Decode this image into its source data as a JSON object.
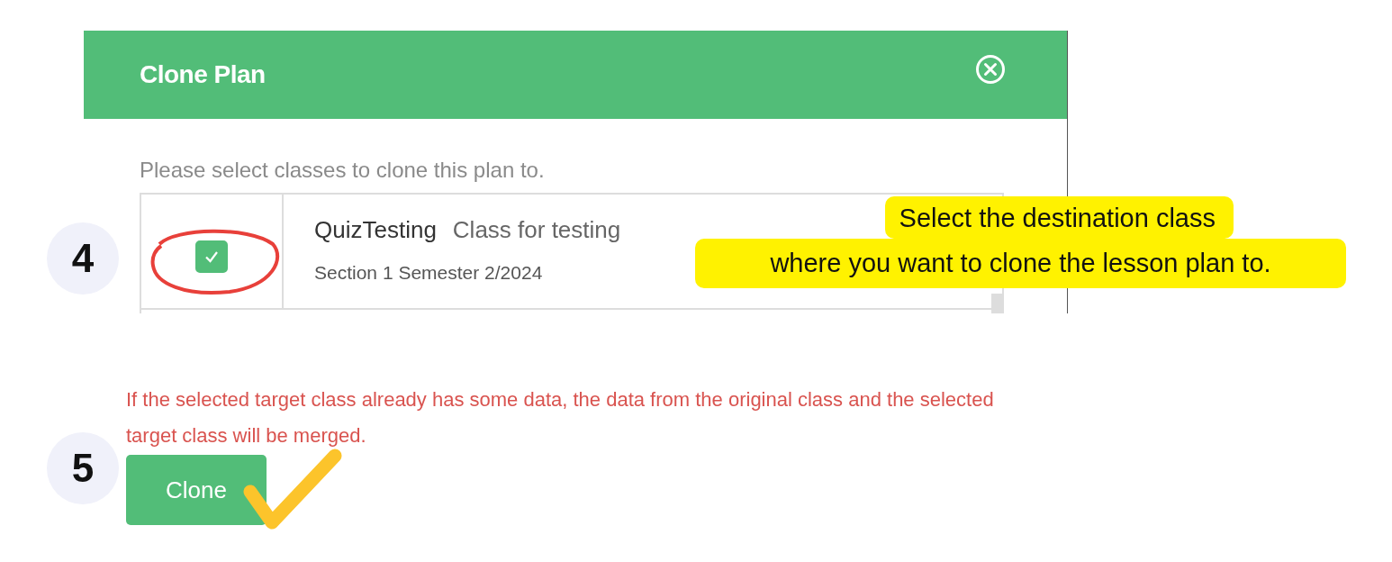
{
  "dialog": {
    "title": "Clone Plan",
    "instruction": "Please select classes to clone this plan to.",
    "classes": [
      {
        "name": "QuizTesting",
        "description": "Class for testing",
        "details": "Section 1 Semester 2/2024",
        "checked": true
      }
    ]
  },
  "warning": "If the selected target class already has some data, the data from the original class and the selected target class will be merged.",
  "buttons": [
    "Clone"
  ],
  "annotations": {
    "steps": [
      "4",
      "5"
    ],
    "callout": [
      "Select the destination class",
      "where you want to clone the lesson plan to."
    ]
  }
}
